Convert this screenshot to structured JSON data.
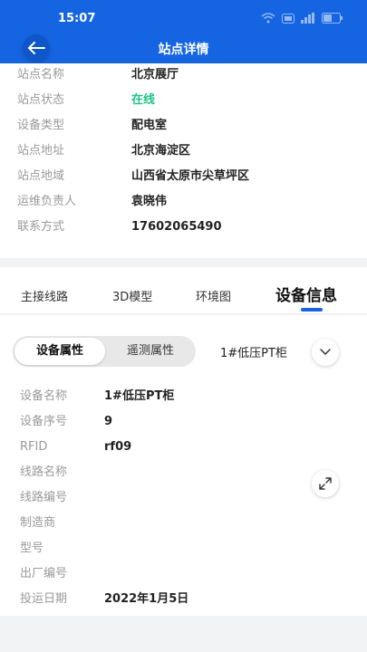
{
  "status_bar": {
    "time": "15:07"
  },
  "header": {
    "title": "站点详情"
  },
  "site": {
    "rows": [
      {
        "label": "站点名称",
        "value": "北京展厅"
      },
      {
        "label": "站点状态",
        "value": "在线"
      },
      {
        "label": "设备类型",
        "value": "配电室"
      },
      {
        "label": "站点地址",
        "value": "北京海淀区"
      },
      {
        "label": "站点地域",
        "value": "山西省太原市尖草坪区"
      },
      {
        "label": "运维负责人",
        "value": "袁晓伟"
      },
      {
        "label": "联系方式",
        "value": "17602065490"
      }
    ]
  },
  "tabs": [
    {
      "label": "主接线路"
    },
    {
      "label": "3D模型"
    },
    {
      "label": "环境图"
    },
    {
      "label": "设备信息"
    }
  ],
  "device": {
    "segment": {
      "active": "设备属性",
      "inactive": "遥测属性"
    },
    "selected_device": "1#低压PT柜",
    "attrs": [
      {
        "label": "设备名称",
        "value": "1#低压PT柜"
      },
      {
        "label": "设备序号",
        "value": "9"
      },
      {
        "label": "RFID",
        "value": "rf09"
      },
      {
        "label": "线路名称",
        "value": ""
      },
      {
        "label": "线路编号",
        "value": ""
      },
      {
        "label": "制造商",
        "value": ""
      },
      {
        "label": "型号",
        "value": ""
      },
      {
        "label": "出厂编号",
        "value": ""
      },
      {
        "label": "投运日期",
        "value": "2022年1月5日"
      }
    ]
  },
  "colors": {
    "primary": "#1565e3",
    "online": "#1ec487"
  }
}
